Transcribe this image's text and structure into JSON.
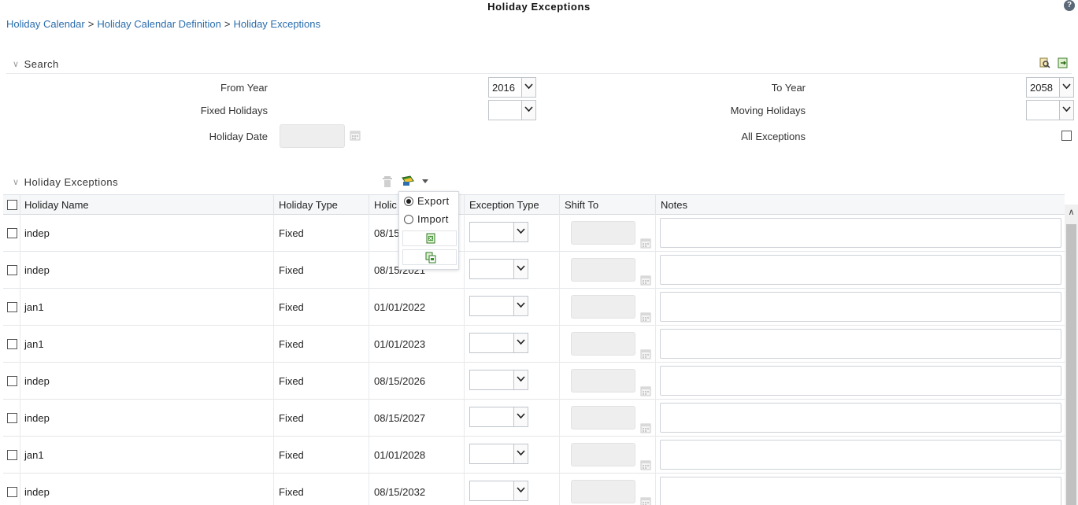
{
  "page": {
    "title": "Holiday Exceptions",
    "help_icon": "help-icon"
  },
  "breadcrumb": {
    "items": [
      "Holiday Calendar",
      "Holiday Calendar Definition",
      "Holiday Exceptions"
    ],
    "separator": ">"
  },
  "search": {
    "section_title": "Search",
    "from_year_label": "From Year",
    "from_year_value": "2016",
    "to_year_label": "To Year",
    "to_year_value": "2058",
    "fixed_holidays_label": "Fixed Holidays",
    "fixed_holidays_value": "",
    "moving_holidays_label": "Moving Holidays",
    "moving_holidays_value": "",
    "holiday_date_label": "Holiday Date",
    "holiday_date_value": "",
    "all_exceptions_label": "All Exceptions",
    "all_exceptions_checked": false,
    "toolbar_icons": [
      "search-icon",
      "reset-icon"
    ]
  },
  "exceptions": {
    "section_title": "Holiday Exceptions",
    "toolbar_icons": [
      "delete-icon",
      "export-import-icon",
      "dropdown-arrow-icon"
    ],
    "popup": {
      "export_label": "Export",
      "import_label": "Import",
      "selected": "Export",
      "icons": [
        "excel-export-icon",
        "copy-file-icon"
      ]
    },
    "columns": [
      "Holiday Name",
      "Holiday Type",
      "Holic",
      "Exception Type",
      "Shift To",
      "Notes"
    ],
    "rows": [
      {
        "name": "indep",
        "type": "Fixed",
        "date": "08/15"
      },
      {
        "name": "indep",
        "type": "Fixed",
        "date": "08/15/2021"
      },
      {
        "name": "jan1",
        "type": "Fixed",
        "date": "01/01/2022"
      },
      {
        "name": "jan1",
        "type": "Fixed",
        "date": "01/01/2023"
      },
      {
        "name": "indep",
        "type": "Fixed",
        "date": "08/15/2026"
      },
      {
        "name": "indep",
        "type": "Fixed",
        "date": "08/15/2027"
      },
      {
        "name": "jan1",
        "type": "Fixed",
        "date": "01/01/2028"
      },
      {
        "name": "indep",
        "type": "Fixed",
        "date": "08/15/2032"
      }
    ]
  },
  "colors": {
    "link": "#2a6dad",
    "header_bg": "#f6f7f9",
    "disabled_field": "#eeeeee"
  }
}
